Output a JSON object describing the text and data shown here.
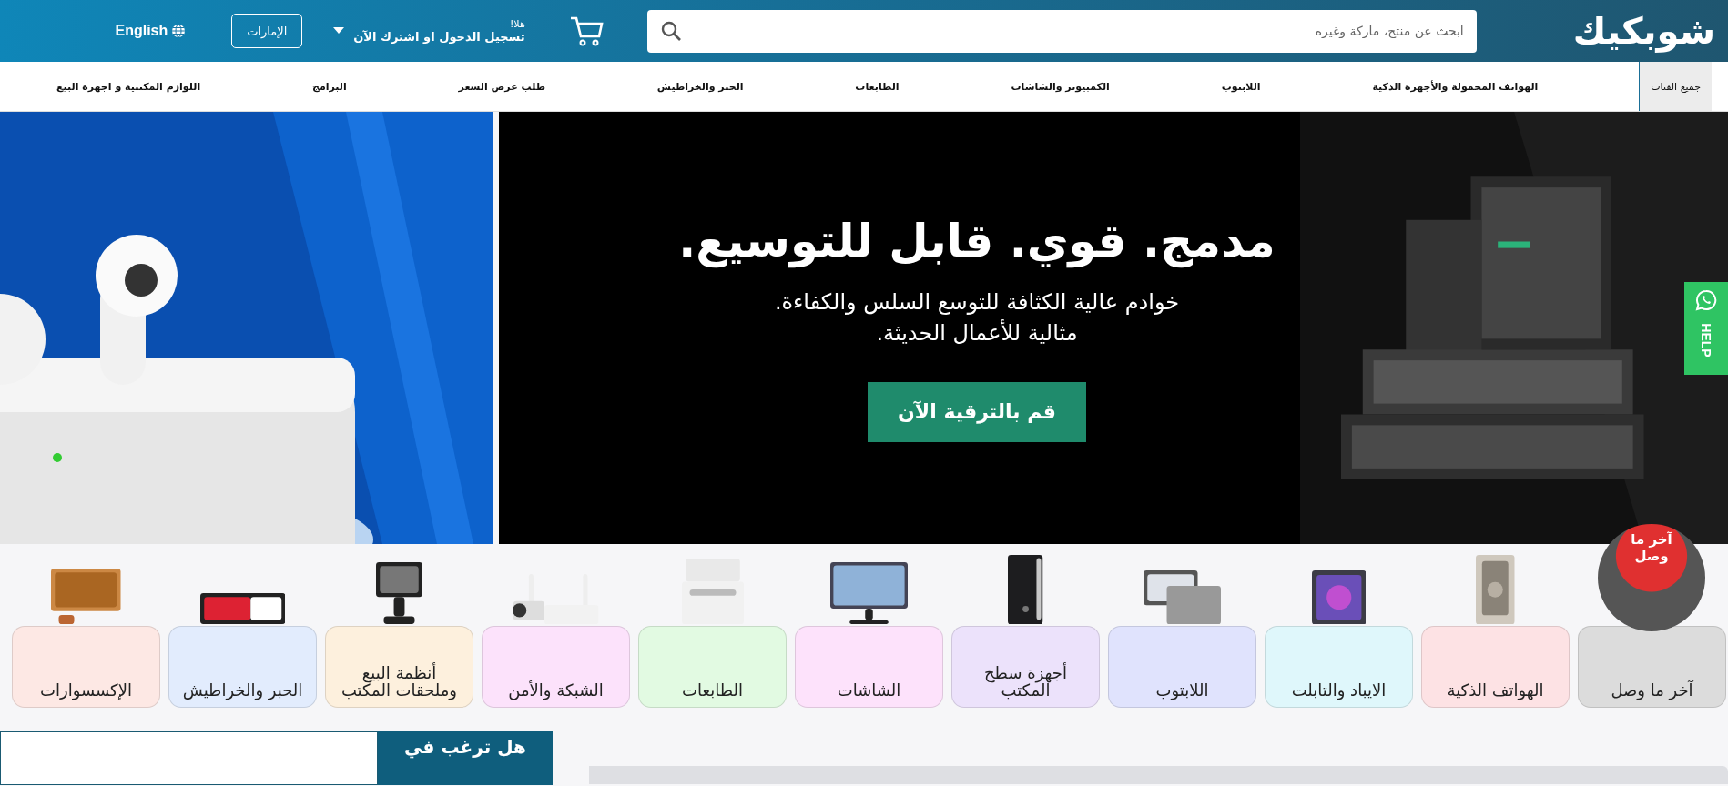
{
  "header": {
    "logo": "شوبكيك",
    "search": {
      "placeholder": "ابحث عن منتج، ماركة وغيره"
    },
    "greeting": "هلا!",
    "login": "تسجيل الدخول او اشترك الآن",
    "region": "الإمارات",
    "language": "English"
  },
  "nav": [
    {
      "label": "جميع الفنات",
      "selected": true
    },
    {
      "label": "الهواتف المحمولة والأجهزة الذكية",
      "selected": false
    },
    {
      "label": "اللابتوب",
      "selected": false
    },
    {
      "label": "الكمبيوتر والشاشات",
      "selected": false
    },
    {
      "label": "الطابعات",
      "selected": false
    },
    {
      "label": "الحبر والخراطيش",
      "selected": false
    },
    {
      "label": "طلب عرض السعر",
      "selected": false
    },
    {
      "label": "البرامج",
      "selected": false
    },
    {
      "label": "اللوازم المكتبية و اجهزة البيع",
      "selected": false
    }
  ],
  "hero": {
    "headline": "مدمج. قوي. قابل للتوسيع.",
    "subline_1": "خوادم عالية الكثافة للتوسع السلس والكفاءة.",
    "subline_2": "مثالية للأعمال الحديثة.",
    "button": "قم بالترقية الآن"
  },
  "help": "HELP",
  "categories": [
    {
      "label": "آخر ما وصل",
      "color": "#dcdcdc",
      "badge": "آخر ما وصل"
    },
    {
      "label": "الهواتف الذكية",
      "color": "#fde2e4"
    },
    {
      "label": "الايباد والتابلت",
      "color": "#dff7fb"
    },
    {
      "label": "اللابتوب",
      "color": "#e0e3fd"
    },
    {
      "label": "أجهزة سطح المكتب",
      "color": "#ece2fb"
    },
    {
      "label": "الشاشات",
      "color": "#fde2fb"
    },
    {
      "label": "الطابعات",
      "color": "#e2fae2"
    },
    {
      "label": "الشبكة والأمن",
      "color": "#fce2fb"
    },
    {
      "label": "أنظمة البيع وملحقات المكتب",
      "color": "#fdf0dd"
    },
    {
      "label": "الحبر والخراطيش",
      "color": "#e2ecfd"
    },
    {
      "label": "الإكسسوارات",
      "color": "#fde8e4"
    }
  ],
  "promo": {
    "title": "هل ترغب في"
  }
}
